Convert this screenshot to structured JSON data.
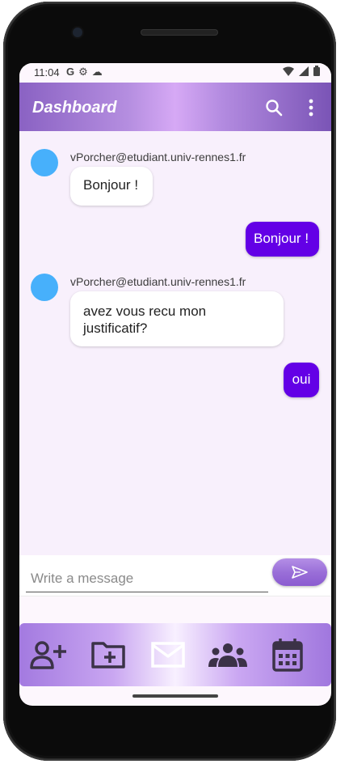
{
  "status_bar": {
    "time": "11:04",
    "left_icons": [
      "google-icon",
      "settings-icon",
      "cloud-icon"
    ],
    "right_icons": [
      "wifi-icon",
      "signal-icon",
      "battery-icon"
    ]
  },
  "app_bar": {
    "title": "Dashboard",
    "actions": [
      "search-icon",
      "more-vert-icon"
    ]
  },
  "messages": [
    {
      "direction": "incoming",
      "sender": "vPorcher@etudiant.univ-rennes1.fr",
      "text": "Bonjour !"
    },
    {
      "direction": "outgoing",
      "text": "Bonjour !"
    },
    {
      "direction": "incoming",
      "sender": "vPorcher@etudiant.univ-rennes1.fr",
      "text": "avez vous recu mon justificatif?"
    },
    {
      "direction": "outgoing",
      "text": "oui"
    }
  ],
  "composer": {
    "placeholder": "Write a message",
    "value": "",
    "send_icon": "send-icon"
  },
  "bottom_nav": {
    "items": [
      "add-user-icon",
      "new-folder-icon",
      "mail-icon",
      "group-icon",
      "calendar-icon"
    ]
  },
  "colors": {
    "outgoing_bubble": "#6300e6",
    "avatar": "#47b0fb",
    "chat_background": "#f8f0fc",
    "accent": "#9a6fd8"
  }
}
